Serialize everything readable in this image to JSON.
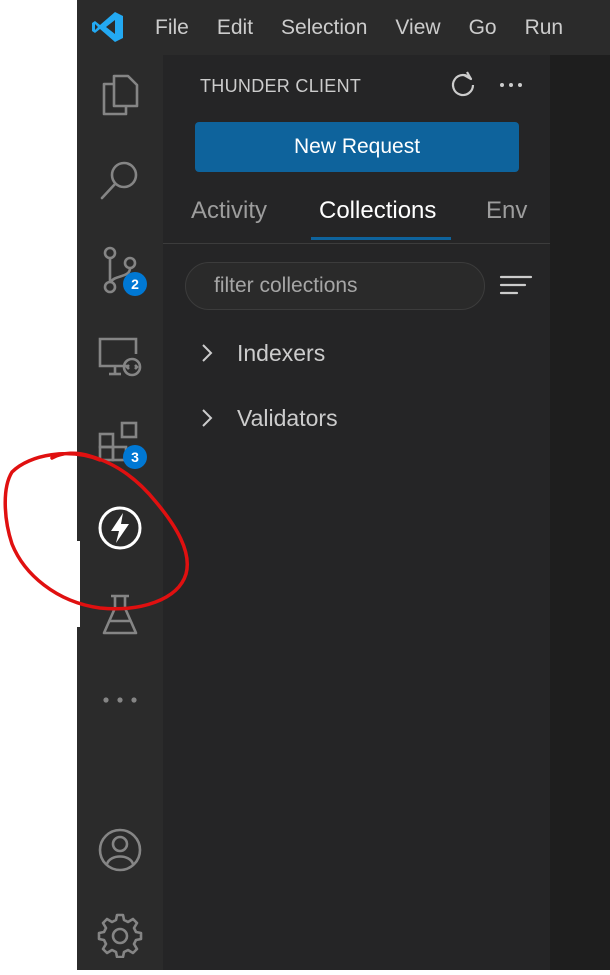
{
  "menu": {
    "items": [
      "File",
      "Edit",
      "Selection",
      "View",
      "Go",
      "Run"
    ]
  },
  "activity_bar": {
    "items": [
      {
        "name": "explorer-icon"
      },
      {
        "name": "search-icon"
      },
      {
        "name": "source-control-icon",
        "badge": "2"
      },
      {
        "name": "remote-explorer-icon"
      },
      {
        "name": "extensions-icon",
        "badge": "3"
      },
      {
        "name": "thunder-client-icon",
        "active": true
      },
      {
        "name": "testing-icon"
      },
      {
        "name": "more-icon"
      },
      {
        "name": "accounts-icon"
      },
      {
        "name": "manage-gear-icon"
      }
    ]
  },
  "sidebar": {
    "title": "THUNDER CLIENT",
    "new_request_label": "New Request",
    "tabs": [
      "Activity",
      "Collections",
      "Env"
    ],
    "active_tab": "Collections",
    "filter_placeholder": "filter collections",
    "collections": [
      "Indexers",
      "Validators"
    ]
  },
  "colors": {
    "accent": "#0e639c",
    "badge": "#0078d4",
    "annotation": "#e01010"
  }
}
